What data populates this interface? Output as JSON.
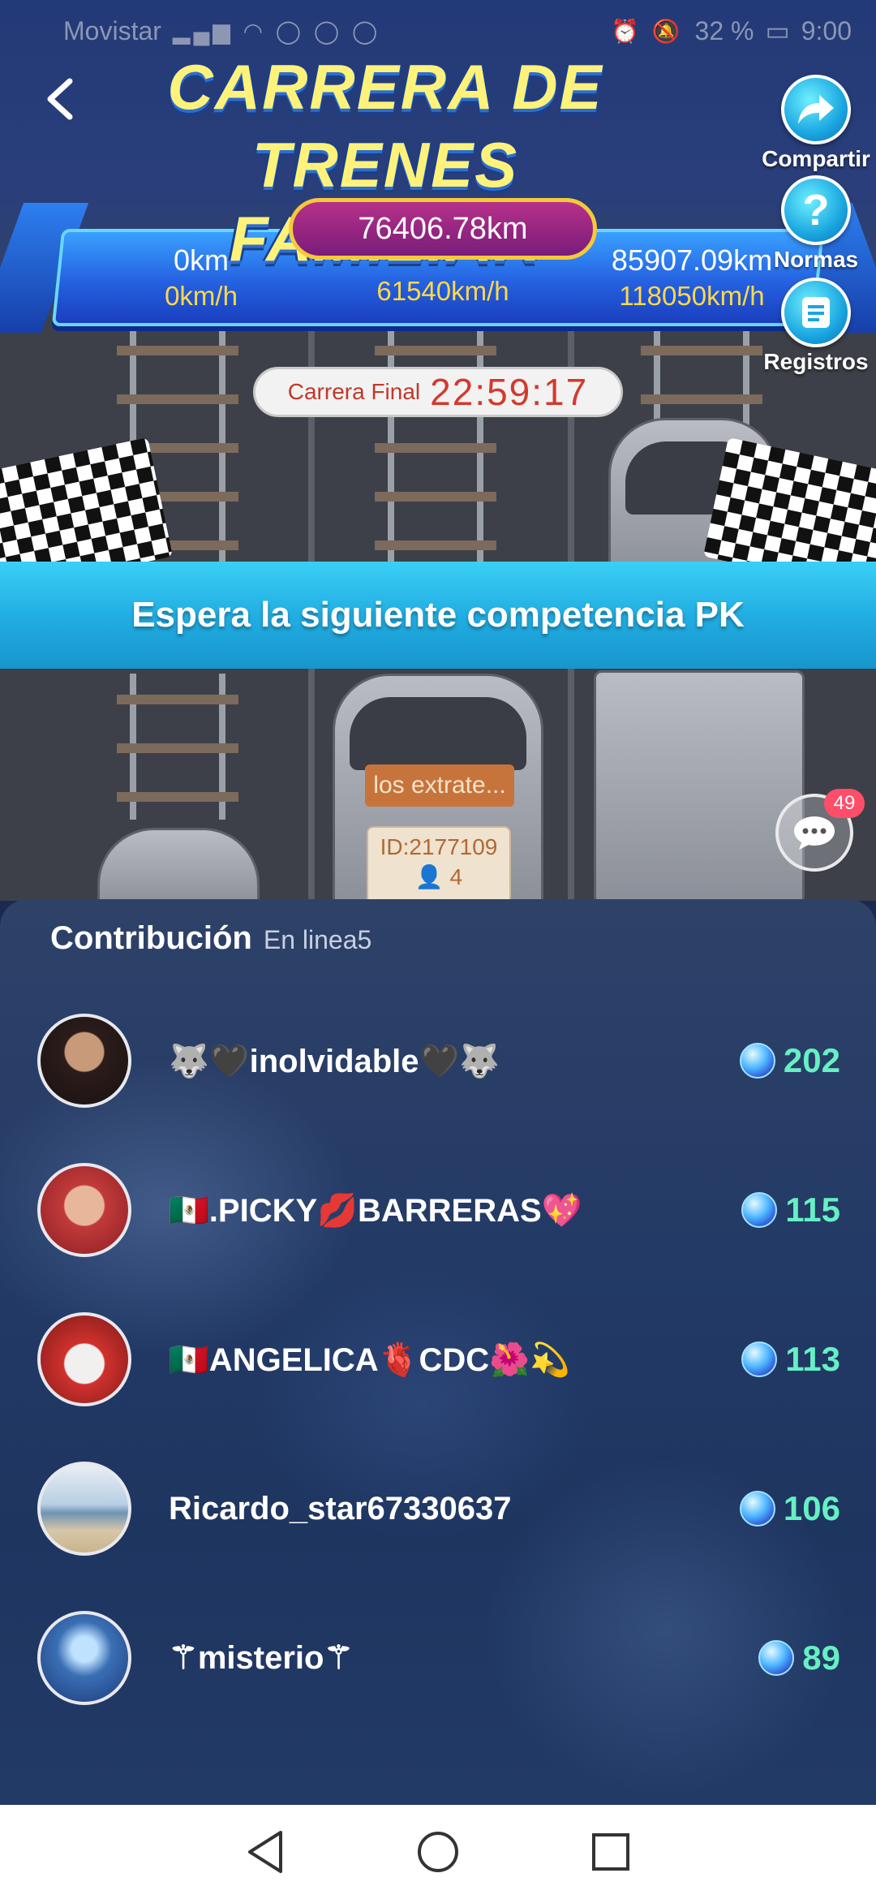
{
  "status_bar": {
    "carrier": "Movistar",
    "battery": "32 %",
    "time": "9:00"
  },
  "header": {
    "title_line1": "CARRERA DE",
    "title_line2": "TRENES FAMILIAR"
  },
  "side_buttons": {
    "share": "Compartir",
    "rules": "Normas",
    "records": "Registros"
  },
  "race": {
    "current_distance": "76406.78km",
    "left_distance": "0km",
    "left_speed": "0km/h",
    "center_speed": "61540km/h",
    "right_distance": "85907.09km",
    "right_speed": "118050km/h",
    "final_label": "Carrera Final",
    "countdown": "22:59:17"
  },
  "banner": {
    "text": "Espera la siguiente competencia PK"
  },
  "train_car": {
    "team_label": "los extrate...",
    "id": "ID:2177109",
    "members": "4"
  },
  "chat": {
    "badge": "49"
  },
  "contribution": {
    "title": "Contribución",
    "online": "En linea5",
    "users": [
      {
        "name": "🐺🖤inolvidable🖤🐺",
        "score": "202",
        "avatar_color": "#3a2a28"
      },
      {
        "name": "🇲🇽.PICKY💋BARRERAS💖",
        "score": "115",
        "avatar_color": "#c23a3a"
      },
      {
        "name": "🇲🇽ANGELICA🫀CDC🌺💫",
        "score": "113",
        "avatar_color": "#d0312d"
      },
      {
        "name": "Ricardo_star67330637",
        "score": "106",
        "avatar_color": "#7fa6c8"
      },
      {
        "name": "⚚misterio⚚",
        "score": "89",
        "avatar_color": "#3a6fb4"
      }
    ]
  },
  "colors": {
    "banner": "#22aee3",
    "score": "#66f0c4",
    "title": "#fff27a",
    "countdown": "#d33a2c"
  },
  "icons": {
    "back": "chevron-left-icon",
    "share": "share-arrow-icon",
    "rules": "question-icon",
    "records": "list-icon",
    "chat": "chat-bubble-icon",
    "gem": "diamond-icon"
  }
}
